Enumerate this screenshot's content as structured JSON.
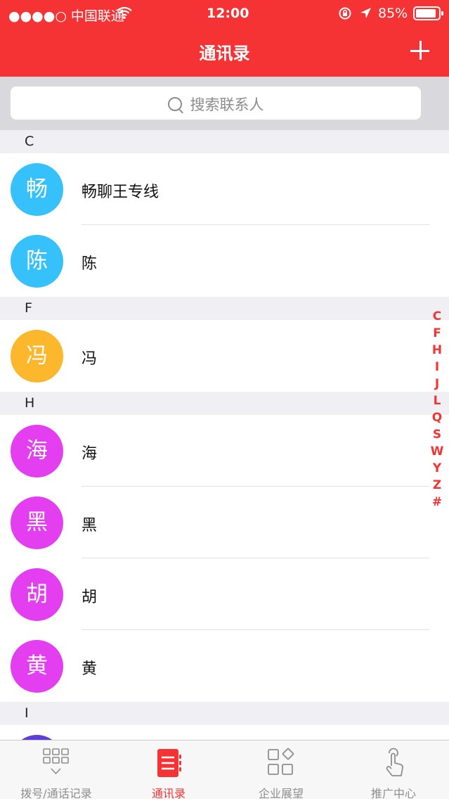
{
  "status_bar": {
    "carrier": "●●●●○ 中国联通",
    "time": "12:00",
    "battery": "85%"
  },
  "nav": {
    "title": "通讯录"
  },
  "search": {
    "placeholder": "搜索联系人"
  },
  "sections": [
    {
      "letter": "C",
      "contacts": [
        {
          "avatar": "畅",
          "name": "畅聊王专线",
          "color": "#36c1fb"
        },
        {
          "avatar": "陈",
          "name": "陈",
          "color": "#36c1fb"
        }
      ]
    },
    {
      "letter": "F",
      "contacts": [
        {
          "avatar": "冯",
          "name": "冯",
          "color": "#fdb72c"
        }
      ]
    },
    {
      "letter": "H",
      "contacts": [
        {
          "avatar": "海",
          "name": "海",
          "color": "#e33ef0"
        },
        {
          "avatar": "黑",
          "name": "黑",
          "color": "#e33ef0"
        },
        {
          "avatar": "胡",
          "name": "胡",
          "color": "#e33ef0"
        },
        {
          "avatar": "黄",
          "name": "黄",
          "color": "#e33ef0"
        }
      ]
    },
    {
      "letter": "I",
      "contacts": [
        {
          "avatar": "",
          "name": "",
          "color": "#5b3fd6"
        }
      ]
    }
  ],
  "index": [
    "C",
    "F",
    "H",
    "I",
    "J",
    "L",
    "Q",
    "S",
    "W",
    "Y",
    "Z",
    "#"
  ],
  "tabs": [
    {
      "label": "拨号/通话记录",
      "icon": "dialpad-icon",
      "active": false
    },
    {
      "label": "通讯录",
      "icon": "contacts-book-icon",
      "active": true
    },
    {
      "label": "企业展望",
      "icon": "apps-grid-icon",
      "active": false
    },
    {
      "label": "推广中心",
      "icon": "touch-hand-icon",
      "active": false
    }
  ],
  "colors": {
    "accent": "#f53234"
  }
}
